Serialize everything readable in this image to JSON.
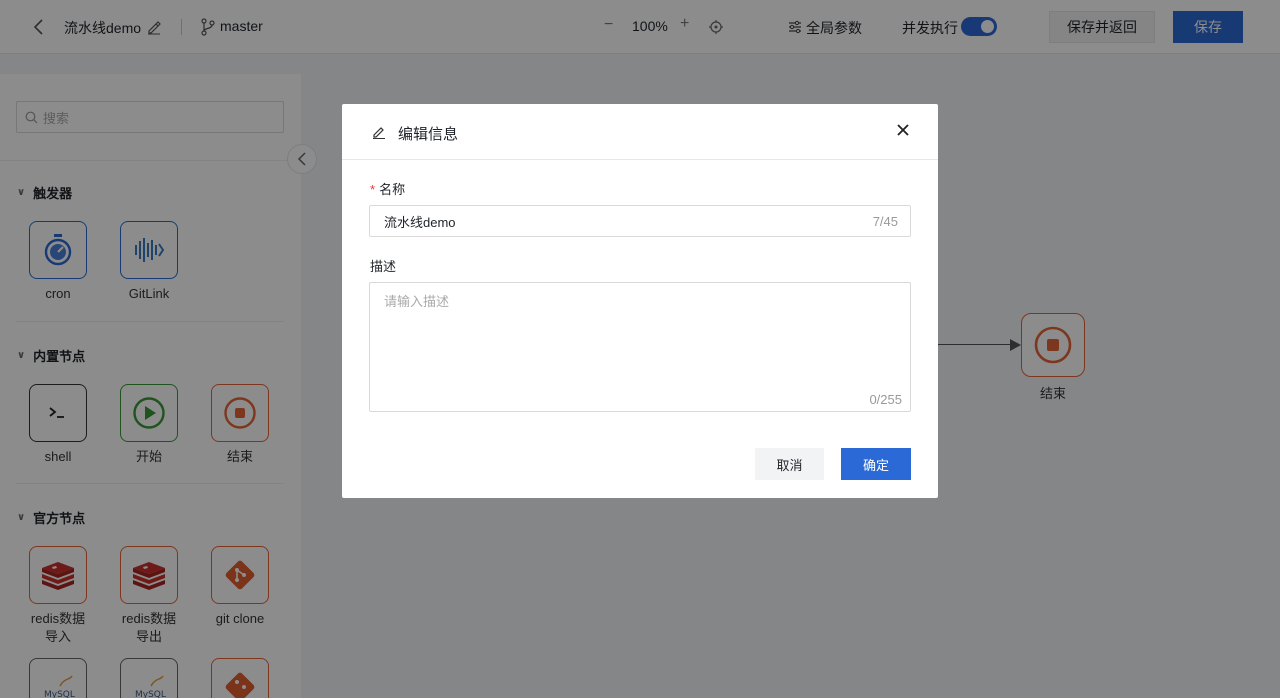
{
  "topbar": {
    "title": "流水线demo",
    "branch": "master",
    "zoom_minus": "−",
    "zoom": "100%",
    "zoom_plus": "+",
    "global_params": "全局参数",
    "concurrent": "并发执行",
    "concurrent_on": true,
    "save_and_return": "保存并返回",
    "save": "保存"
  },
  "sidebar": {
    "search_placeholder": "搜索",
    "sections": [
      {
        "title": "触发器",
        "nodes": [
          {
            "label": "cron",
            "icon": "stopwatch-icon"
          },
          {
            "label": "GitLink",
            "icon": "gitlink-logo-icon"
          }
        ]
      },
      {
        "title": "内置节点",
        "nodes": [
          {
            "label": "shell",
            "icon": "terminal-icon"
          },
          {
            "label": "开始",
            "icon": "play-icon"
          },
          {
            "label": "结束",
            "icon": "stop-icon"
          }
        ]
      },
      {
        "title": "官方节点",
        "nodes": [
          {
            "label": "redis数据\n导入",
            "icon": "redis-icon"
          },
          {
            "label": "redis数据\n导出",
            "icon": "redis-icon"
          },
          {
            "label": "git clone",
            "icon": "git-icon"
          }
        ]
      }
    ]
  },
  "canvas": {
    "end_node_label": "结束"
  },
  "modal": {
    "title": "编辑信息",
    "name_label": "名称",
    "name_value": "流水线demo",
    "name_count": "7/45",
    "desc_label": "描述",
    "desc_placeholder": "请输入描述",
    "desc_count": "0/255",
    "cancel": "取消",
    "ok": "确定"
  },
  "colors": {
    "primary": "#2b6ad6",
    "danger": "#e5653a",
    "success": "#3a9a3a"
  }
}
